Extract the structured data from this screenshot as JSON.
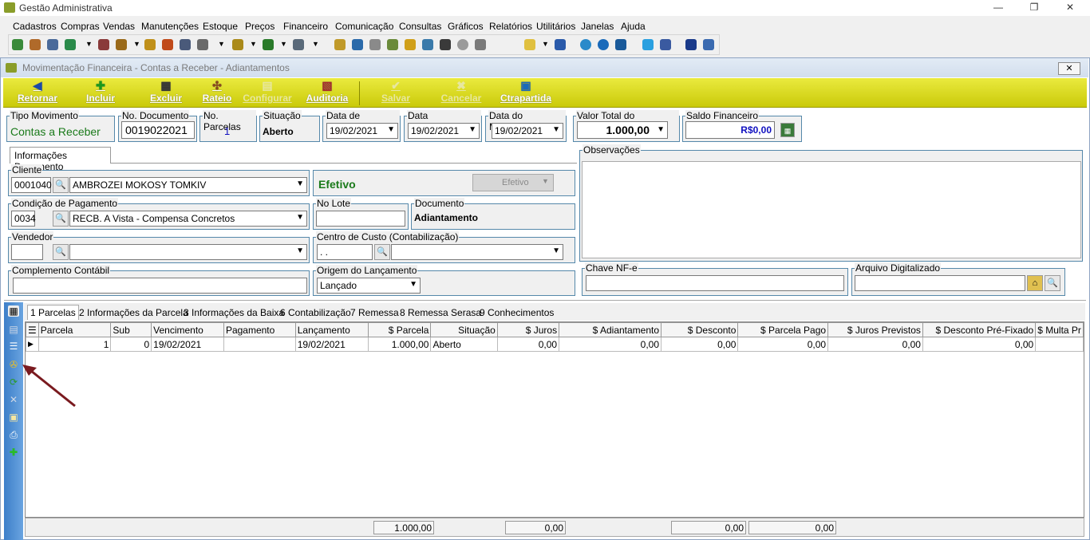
{
  "app": {
    "title": "Gestão Administrativa",
    "minimize": "—",
    "restore": "❐",
    "close": "✕"
  },
  "menu": [
    "Cadastros",
    "Compras",
    "Vendas",
    "Manutenções",
    "Estoque",
    "Preços",
    "Financeiro",
    "Comunicação",
    "Consultas",
    "Gráficos",
    "Relatórios",
    "Utilitários",
    "Janelas",
    "Ajuda"
  ],
  "child": {
    "title": "Movimentação Financeira - Contas a Receber - Adiantamentos",
    "close": "✕"
  },
  "actions": [
    {
      "label": "Retornar",
      "icon": "◀",
      "enabled": true
    },
    {
      "label": "Incluir",
      "icon": "✚",
      "enabled": true
    },
    {
      "label": "Excluir",
      "icon": "▦",
      "enabled": true
    },
    {
      "label": "Rateio",
      "icon": "✣",
      "enabled": true
    },
    {
      "label": "Configurar",
      "icon": "▤",
      "enabled": false
    },
    {
      "label": "Auditoria",
      "icon": "▧",
      "enabled": true
    },
    {
      "label": "Salvar",
      "icon": "✔",
      "enabled": false
    },
    {
      "label": "Cancelar",
      "icon": "✖",
      "enabled": false
    },
    {
      "label": "Ctrapartida",
      "icon": "▣",
      "enabled": true
    }
  ],
  "header": {
    "tipo_movimento": {
      "label": "Tipo Movimento",
      "value": "Contas a Receber"
    },
    "no_documento": {
      "label": "No. Documento",
      "value": "0019022021"
    },
    "no_parcelas": {
      "label": "No. Parcelas",
      "value": "1"
    },
    "situacao": {
      "label": "Situação",
      "value": "Aberto"
    },
    "data_emissao": {
      "label": "Data de Emissão",
      "value": "19/02/2021"
    },
    "data_competencia": {
      "label": "Data Competência",
      "value": "19/02/2021"
    },
    "data_movimento": {
      "label": "Data do Movimento",
      "value": "19/02/2021"
    },
    "valor_total": {
      "label": "Valor Total do Documento",
      "value": "1.000,00"
    },
    "saldo_financeiro": {
      "label": "Saldo Financeiro",
      "value": "R$0,00"
    }
  },
  "doc_tab": "Informações Documento",
  "cliente": {
    "label": "Cliente",
    "code": "0001040",
    "name": "AMBROZEI MOKOSY TOMKIV"
  },
  "status": {
    "value": "Efetivo",
    "button": "Efetivo"
  },
  "condicao": {
    "label": "Condição de Pagamento",
    "code": "0034",
    "name": "RECB. A Vista - Compensa Concretos"
  },
  "no_lote": {
    "label": "No Lote",
    "value": ""
  },
  "documento": {
    "label": "Documento",
    "value": "Adiantamento"
  },
  "vendedor": {
    "label": "Vendedor",
    "code": "",
    "name": ""
  },
  "centro_custo": {
    "label": "Centro de Custo (Contabilização)",
    "code": " .  .",
    "name": ""
  },
  "complemento": {
    "label": "Complemento Contábil",
    "value": ""
  },
  "origem": {
    "label": "Origem do Lançamento",
    "value": "Lançado"
  },
  "observacoes": {
    "label": "Observações"
  },
  "chave_nfe": {
    "label": "Chave NF-e",
    "value": ""
  },
  "arquivo": {
    "label": "Arquivo Digitalizado",
    "value": ""
  },
  "bottom_tabs": [
    "1 Parcelas",
    "2 Informações da Parcela",
    "3 Informações da Baixa",
    "6 Contabilização",
    "7 Remessa",
    "8 Remessa Serasa",
    "9 Conhecimentos"
  ],
  "grid": {
    "columns": [
      "Parcela",
      "Sub",
      "Vencimento",
      "Pagamento",
      "Lançamento",
      "$ Parcela",
      "Situação",
      "$ Juros",
      "$ Adiantamento",
      "$ Desconto",
      "$ Parcela Pago",
      "$ Juros Previstos",
      "$ Desconto Pré-Fixado",
      "$ Multa Pr"
    ],
    "rows": [
      [
        "1",
        "0",
        "19/02/2021",
        "",
        "19/02/2021",
        "1.000,00",
        "Aberto",
        "0,00",
        "0,00",
        "0,00",
        "0,00",
        "0,00",
        "0,00",
        ""
      ]
    ]
  },
  "totals": {
    "parcela": "1.000,00",
    "juros": "0,00",
    "desconto": "0,00",
    "parcela_pago": "0,00"
  },
  "colors": {
    "accent_yellow": "#dada20",
    "sidebar_blue": "#4a8bd2",
    "arrow": "#7a1a1f",
    "green_text": "#1a7a1a",
    "blue_text": "#1010c0"
  }
}
